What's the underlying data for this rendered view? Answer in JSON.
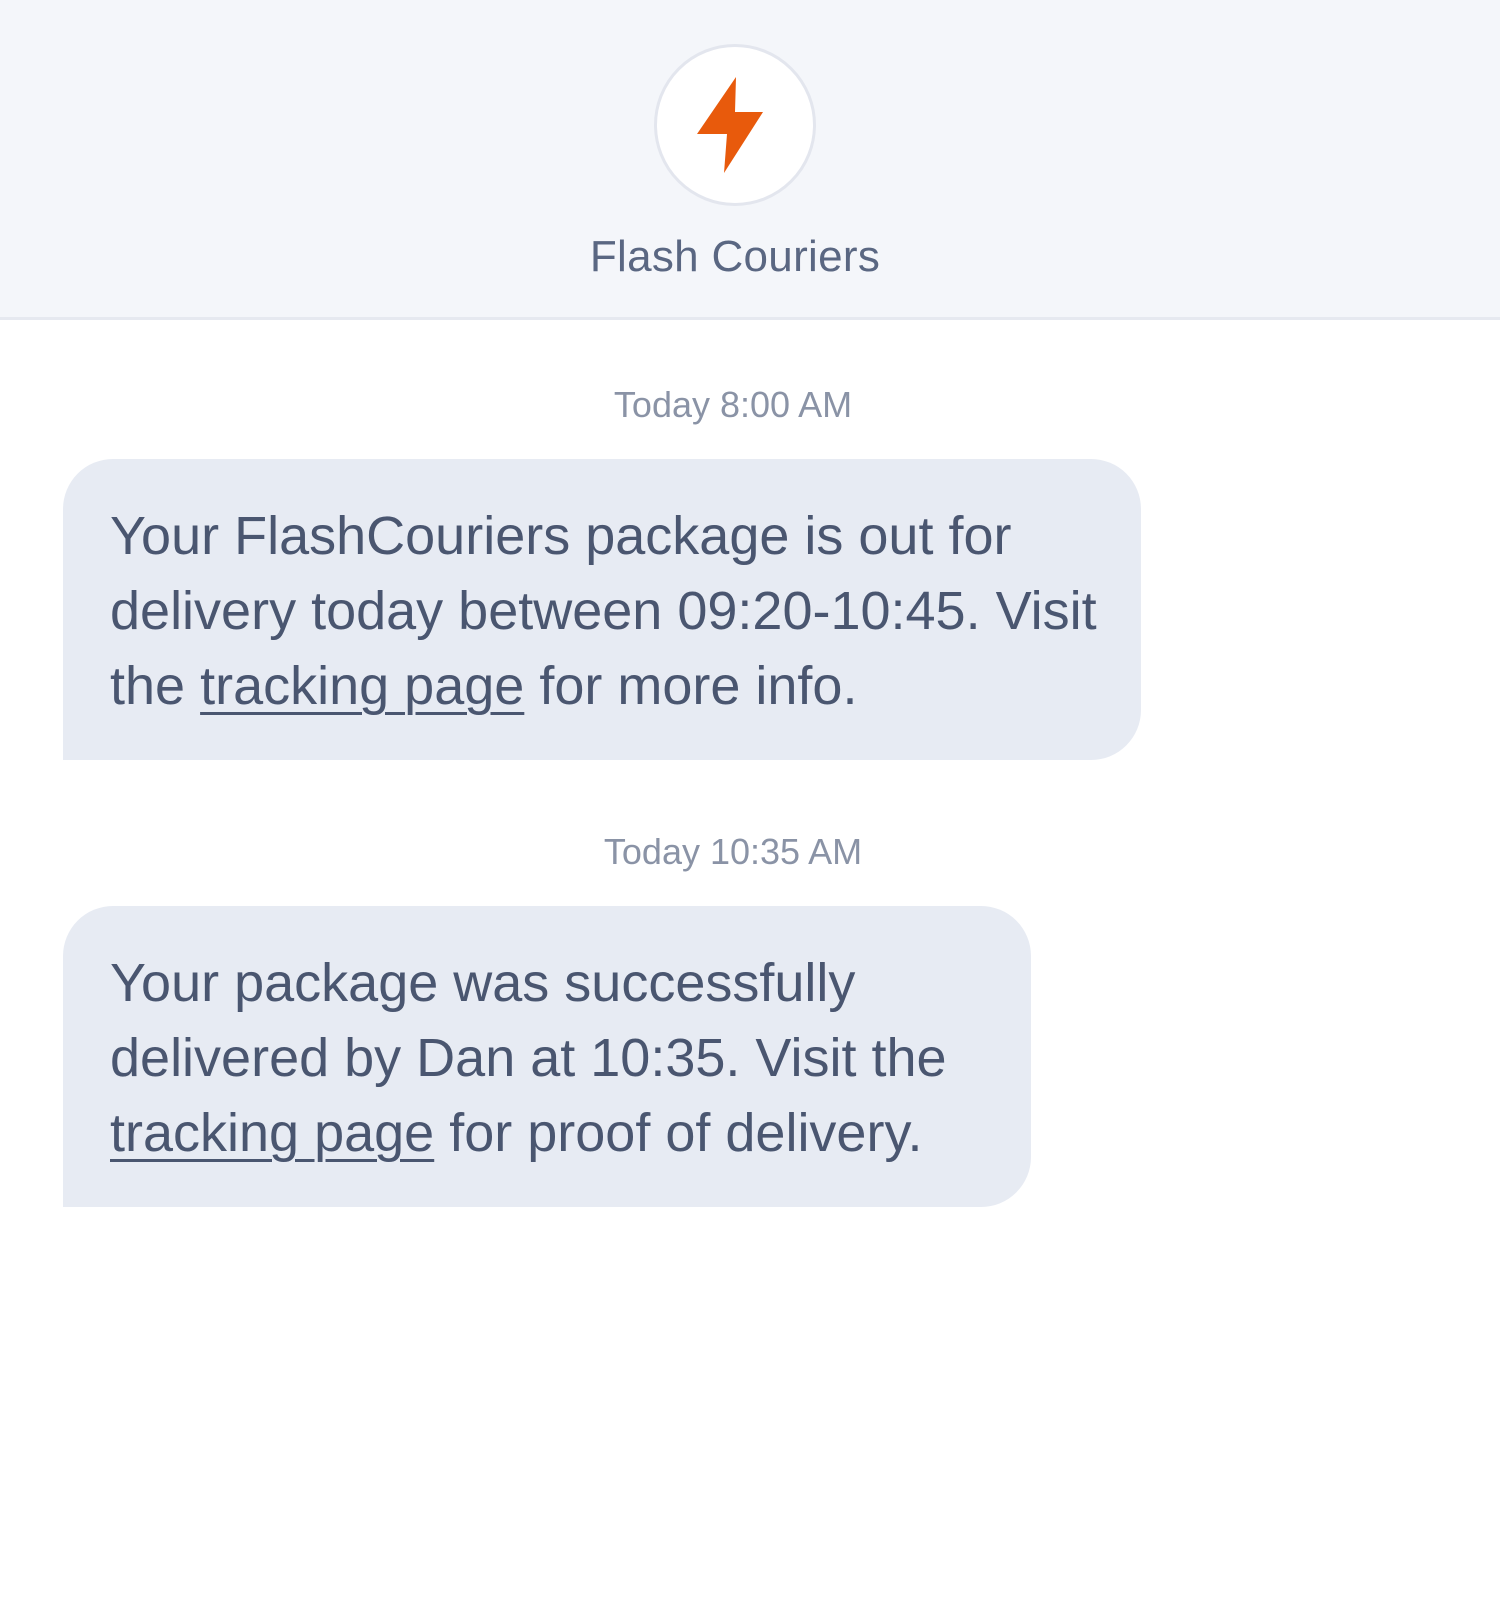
{
  "header": {
    "sender_name": "Flash Couriers",
    "avatar_icon": "lightning-bolt-icon",
    "accent_color": "#e85a0c"
  },
  "messages": [
    {
      "timestamp": "Today 8:00 AM",
      "text_before": "Your FlashCouriers package is out for delivery today between 09:20-10:45. Visit the",
      "link_text": "tracking page",
      "text_after": "for more info."
    },
    {
      "timestamp": "Today 10:35 AM",
      "text_before": "Your package was successfully delivered by Dan at 10:35. Visit the",
      "link_text": "tracking page",
      "text_after": "for proof of delivery."
    }
  ]
}
